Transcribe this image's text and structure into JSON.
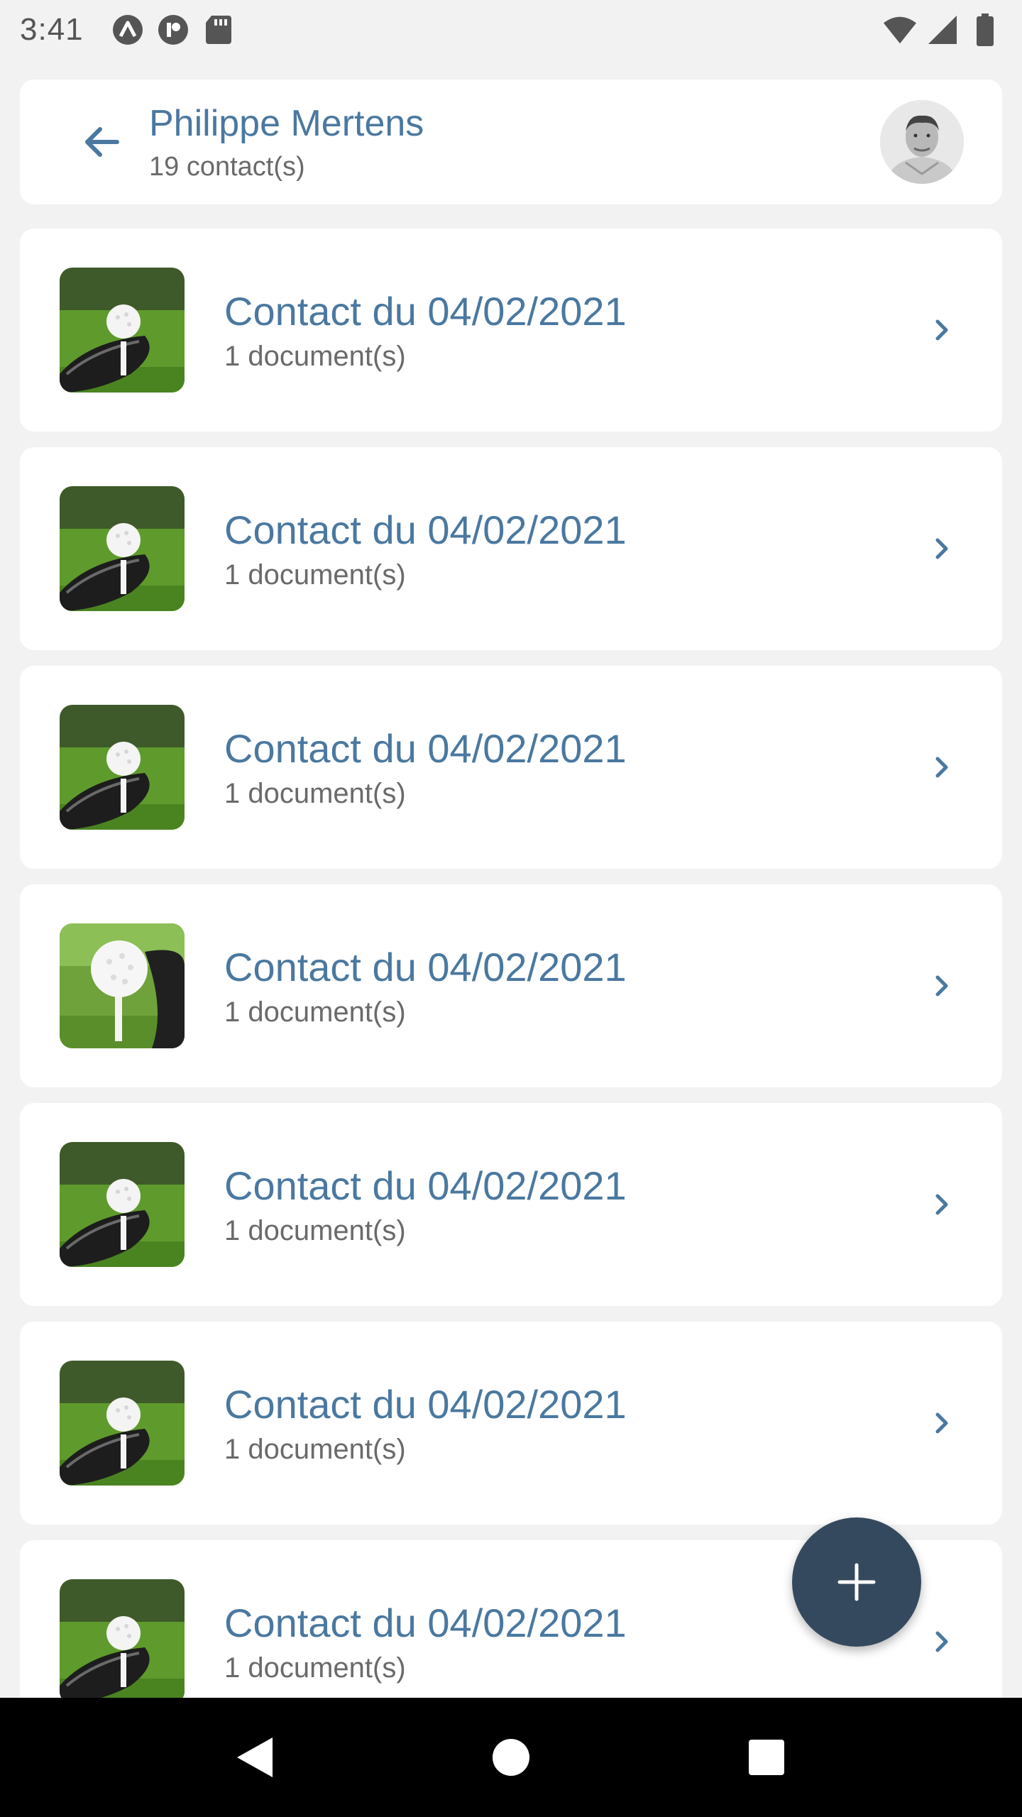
{
  "status_bar": {
    "time": "3:41",
    "left_icons": [
      "app-icon-a",
      "app-icon-r",
      "sd-card-icon"
    ],
    "right_icons": [
      "wifi-icon",
      "signal-icon",
      "battery-icon"
    ]
  },
  "header": {
    "title": "Philippe Mertens",
    "subtitle": "19 contact(s)",
    "back_icon": "arrow-left-icon",
    "avatar": "avatar"
  },
  "contacts": [
    {
      "title": "Contact du 04/02/2021",
      "subtitle": "1 document(s)",
      "thumb": "golf-driver"
    },
    {
      "title": "Contact du 04/02/2021",
      "subtitle": "1 document(s)",
      "thumb": "golf-driver"
    },
    {
      "title": "Contact du 04/02/2021",
      "subtitle": "1 document(s)",
      "thumb": "golf-driver"
    },
    {
      "title": "Contact du 04/02/2021",
      "subtitle": "1 document(s)",
      "thumb": "golf-ball-closeup"
    },
    {
      "title": "Contact du 04/02/2021",
      "subtitle": "1 document(s)",
      "thumb": "golf-driver"
    },
    {
      "title": "Contact du 04/02/2021",
      "subtitle": "1 document(s)",
      "thumb": "golf-driver"
    },
    {
      "title": "Contact du 04/02/2021",
      "subtitle": "1 document(s)",
      "thumb": "golf-driver"
    }
  ],
  "fab": {
    "icon": "plus-icon"
  },
  "nav_bar": {
    "icons": [
      "back-triangle-icon",
      "home-circle-icon",
      "recents-square-icon"
    ]
  },
  "colors": {
    "accent": "#4a78a0",
    "fab": "#35495e",
    "background": "#f2f2f2",
    "card": "#ffffff",
    "secondary_text": "#6a6a6a"
  }
}
